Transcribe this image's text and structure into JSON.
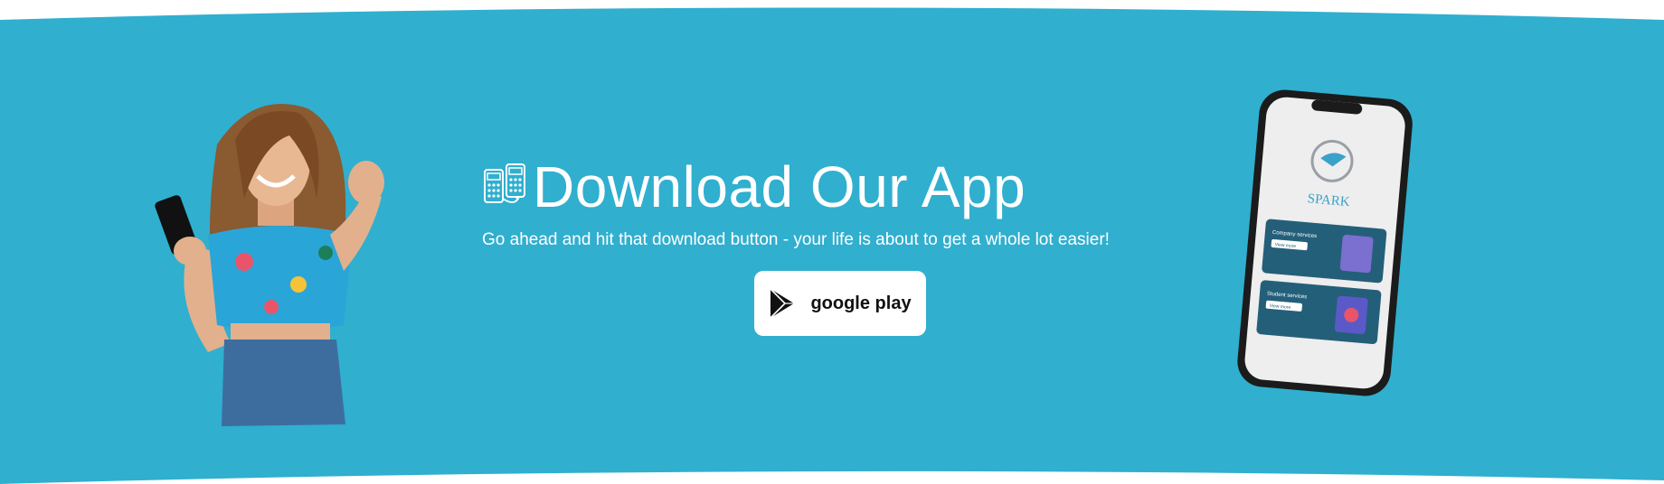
{
  "colors": {
    "banner_background": "#30afcf",
    "page_background": "#ffffff",
    "button_background": "#ffffff",
    "phone_card": "#245f7a"
  },
  "hero": {
    "icon": "mobile-payment-icon",
    "title": "Download Our App",
    "subtitle": "Go ahead and hit that download button - your life is about to get a whole lot easier!",
    "button": {
      "label": "google play",
      "icon": "google-play-icon"
    }
  },
  "phone_screen": {
    "brand": "SPARK",
    "cards": [
      {
        "title": "Company services",
        "button": "View more"
      },
      {
        "title": "Student services",
        "button": "View more"
      }
    ]
  }
}
